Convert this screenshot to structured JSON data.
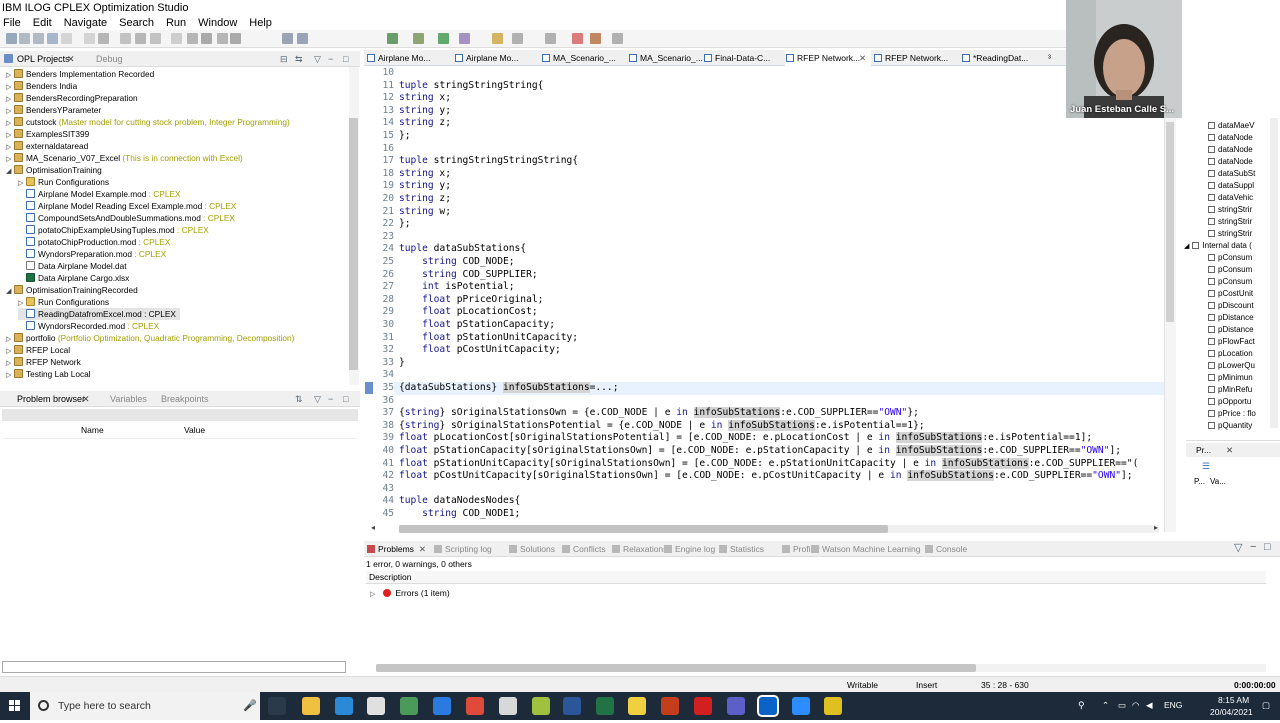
{
  "window": {
    "title": "IBM ILOG CPLEX Optimization Studio"
  },
  "menu": [
    "File",
    "Edit",
    "Navigate",
    "Search",
    "Run",
    "Window",
    "Help"
  ],
  "left_top": {
    "tab_active": "OPL Projects",
    "tab_inactive": "Debug"
  },
  "tree": [
    {
      "exp": "▷",
      "indent": 0,
      "icon": "proj",
      "label": "Benders Implementation Recorded",
      "note": ""
    },
    {
      "exp": "▷",
      "indent": 0,
      "icon": "proj",
      "label": "Benders India",
      "note": ""
    },
    {
      "exp": "▷",
      "indent": 0,
      "icon": "proj",
      "label": "BendersRecordingPreparation",
      "note": ""
    },
    {
      "exp": "▷",
      "indent": 0,
      "icon": "proj",
      "label": "BendersYParameter",
      "note": ""
    },
    {
      "exp": "▷",
      "indent": 0,
      "icon": "proj",
      "label": "cutstock",
      "note": " (Master model for cutting stock problem, Integer Programming)"
    },
    {
      "exp": "▷",
      "indent": 0,
      "icon": "proj",
      "label": "ExamplesSIT399",
      "note": ""
    },
    {
      "exp": "▷",
      "indent": 0,
      "icon": "proj",
      "label": "externaldataread",
      "note": ""
    },
    {
      "exp": "▷",
      "indent": 0,
      "icon": "proj",
      "label": "MA_Scenario_V07_Excel",
      "note": " (This is in connection with Excel)"
    },
    {
      "exp": "◢",
      "indent": 0,
      "icon": "proj",
      "label": "OptimisationTraining",
      "note": ""
    },
    {
      "exp": "▷",
      "indent": 1,
      "icon": "run",
      "label": "Run Configurations",
      "note": ""
    },
    {
      "exp": "",
      "indent": 1,
      "icon": "mod",
      "label": "Airplane Model Example.mod",
      "note": " : CPLEX"
    },
    {
      "exp": "",
      "indent": 1,
      "icon": "mod",
      "label": "Airplane Model Reading Excel Example.mod",
      "note": " : CPLEX"
    },
    {
      "exp": "",
      "indent": 1,
      "icon": "mod",
      "label": "CompoundSetsAndDoubleSummations.mod",
      "note": " : CPLEX"
    },
    {
      "exp": "",
      "indent": 1,
      "icon": "mod",
      "label": "potatoChipExampleUsingTuples.mod",
      "note": " : CPLEX"
    },
    {
      "exp": "",
      "indent": 1,
      "icon": "mod",
      "label": "potatoChipProduction.mod",
      "note": " : CPLEX"
    },
    {
      "exp": "",
      "indent": 1,
      "icon": "mod",
      "label": "WyndorsPreparation.mod",
      "note": " : CPLEX"
    },
    {
      "exp": "",
      "indent": 1,
      "icon": "dat",
      "label": "Data Airplane Model.dat",
      "note": ""
    },
    {
      "exp": "",
      "indent": 1,
      "icon": "xls",
      "label": "Data Airplane Cargo.xlsx",
      "note": ""
    },
    {
      "exp": "◢",
      "indent": 0,
      "icon": "proj",
      "label": "OptimisationTrainingRecorded",
      "note": ""
    },
    {
      "exp": "▷",
      "indent": 1,
      "icon": "run",
      "label": "Run Configurations",
      "note": ""
    },
    {
      "exp": "",
      "indent": 1,
      "icon": "mod",
      "label": "ReadingDatafromExcel.mod : CPLEX",
      "note": "",
      "selected": true
    },
    {
      "exp": "",
      "indent": 1,
      "icon": "mod",
      "label": "WyndorsRecorded.mod",
      "note": " : CPLEX"
    },
    {
      "exp": "▷",
      "indent": 0,
      "icon": "proj",
      "label": "portfolio",
      "note": " (Portfolio Optimization, Quadratic Programming, Decomposition)"
    },
    {
      "exp": "▷",
      "indent": 0,
      "icon": "proj",
      "label": "RFEP Local",
      "note": ""
    },
    {
      "exp": "▷",
      "indent": 0,
      "icon": "proj",
      "label": "RFEP Network",
      "note": ""
    },
    {
      "exp": "▷",
      "indent": 0,
      "icon": "proj",
      "label": "Testing Lab Local",
      "note": ""
    }
  ],
  "left_bottom": {
    "tab_active": "Problem browser",
    "tab2": "Variables",
    "tab3": "Breakpoints",
    "col_name": "Name",
    "col_value": "Value"
  },
  "editor_tabs": [
    {
      "label": "Airplane Mo...",
      "active": false
    },
    {
      "label": "Airplane Mo...",
      "active": false
    },
    {
      "label": "MA_Scenario_...",
      "active": false
    },
    {
      "label": "MA_Scenario_...",
      "active": false
    },
    {
      "label": "Final-Data-C...",
      "active": false
    },
    {
      "label": "RFEP Network...",
      "active": true
    },
    {
      "label": "RFEP Network...",
      "active": false
    },
    {
      "label": "*ReadingDat...",
      "active": false
    },
    {
      "label": "³",
      "active": false
    }
  ],
  "code": [
    {
      "n": "10",
      "t": ""
    },
    {
      "n": "11",
      "t": "tuple stringStringString{"
    },
    {
      "n": "12",
      "t": "string x;"
    },
    {
      "n": "13",
      "t": "string y;"
    },
    {
      "n": "14",
      "t": "string z;"
    },
    {
      "n": "15",
      "t": "};"
    },
    {
      "n": "16",
      "t": ""
    },
    {
      "n": "17",
      "t": "tuple stringStringStringString{"
    },
    {
      "n": "18",
      "t": "string x;"
    },
    {
      "n": "19",
      "t": "string y;"
    },
    {
      "n": "20",
      "t": "string z;"
    },
    {
      "n": "21",
      "t": "string w;"
    },
    {
      "n": "22",
      "t": "};"
    },
    {
      "n": "23",
      "t": ""
    },
    {
      "n": "24",
      "t": "tuple dataSubStations{"
    },
    {
      "n": "25",
      "t": "    string COD_NODE;"
    },
    {
      "n": "26",
      "t": "    string COD_SUPPLIER;"
    },
    {
      "n": "27",
      "t": "    int isPotential;"
    },
    {
      "n": "28",
      "t": "    float pPriceOriginal;"
    },
    {
      "n": "29",
      "t": "    float pLocationCost;"
    },
    {
      "n": "30",
      "t": "    float pStationCapacity;"
    },
    {
      "n": "31",
      "t": "    float pStationUnitCapacity;"
    },
    {
      "n": "32",
      "t": "    float pCostUnitCapacity;"
    },
    {
      "n": "33",
      "t": "}"
    },
    {
      "n": "34",
      "t": ""
    },
    {
      "n": "35",
      "t": "{dataSubStations} infoSubStations=...;",
      "current": true
    },
    {
      "n": "36",
      "t": ""
    },
    {
      "n": "37",
      "t": "{string} sOriginalStationsOwn = {e.COD_NODE | e in infoSubStations:e.COD_SUPPLIER==\"OWN\"};"
    },
    {
      "n": "38",
      "t": "{string} sOriginalStationsPotential = {e.COD_NODE | e in infoSubStations:e.isPotential==1};"
    },
    {
      "n": "39",
      "t": "float pLocationCost[sOriginalStationsPotential] = [e.COD_NODE: e.pLocationCost | e in infoSubStations:e.isPotential==1];"
    },
    {
      "n": "40",
      "t": "float pStationCapacity[sOriginalStationsOwn] = [e.COD_NODE: e.pStationCapacity | e in infoSubStations:e.COD_SUPPLIER==\"OWN\"];"
    },
    {
      "n": "41",
      "t": "float pStationUnitCapacity[sOriginalStationsOwn] = [e.COD_NODE: e.pStationUnitCapacity | e in infoSubStations:e.COD_SUPPLIER==\"("
    },
    {
      "n": "42",
      "t": "float pCostUnitCapacity[sOriginalStationsOwn] = [e.COD_NODE: e.pCostUnitCapacity | e in infoSubStations:e.COD_SUPPLIER==\"OWN\"];"
    },
    {
      "n": "43",
      "t": ""
    },
    {
      "n": "44",
      "t": "tuple dataNodesNodes{"
    },
    {
      "n": "45",
      "t": "    string COD_NODE1;"
    }
  ],
  "outline": [
    {
      "indent": 2,
      "label": "dataMaeV"
    },
    {
      "indent": 2,
      "label": "dataNode"
    },
    {
      "indent": 2,
      "label": "dataNode"
    },
    {
      "indent": 2,
      "label": "dataNode"
    },
    {
      "indent": 2,
      "label": "dataSubSt"
    },
    {
      "indent": 2,
      "label": "dataSuppl"
    },
    {
      "indent": 2,
      "label": "dataVehic"
    },
    {
      "indent": 2,
      "label": "stringStrir"
    },
    {
      "indent": 2,
      "label": "stringStrir"
    },
    {
      "indent": 2,
      "label": "stringStrir"
    },
    {
      "indent": 1,
      "label": "Internal data ("
    },
    {
      "indent": 2,
      "label": "pConsum"
    },
    {
      "indent": 2,
      "label": "pConsum"
    },
    {
      "indent": 2,
      "label": "pConsum"
    },
    {
      "indent": 2,
      "label": "pCostUnit"
    },
    {
      "indent": 2,
      "label": "pDiscount"
    },
    {
      "indent": 2,
      "label": "pDistance"
    },
    {
      "indent": 2,
      "label": "pDistance"
    },
    {
      "indent": 2,
      "label": "pFlowFact"
    },
    {
      "indent": 2,
      "label": "pLocation"
    },
    {
      "indent": 2,
      "label": "pLowerQu"
    },
    {
      "indent": 2,
      "label": "pMinimun"
    },
    {
      "indent": 2,
      "label": "pMinRefu"
    },
    {
      "indent": 2,
      "label": "pOpportu"
    },
    {
      "indent": 2,
      "label": "pPrice : flo"
    },
    {
      "indent": 2,
      "label": "pQuantity"
    }
  ],
  "right_small": {
    "tab": "Pr...",
    "col1": "P...",
    "col2": "Va..."
  },
  "bottom_tabs": [
    "Problems",
    "Scripting log",
    "Solutions",
    "Conflicts",
    "Relaxations",
    "Engine log",
    "Statistics",
    "Profiler",
    "Watson Machine Learning",
    "Console"
  ],
  "problems": {
    "summary": "1 error, 0 warnings, 0 others",
    "col": "Description",
    "row": "Errors (1 item)"
  },
  "status": {
    "writable": "Writable",
    "mode": "Insert",
    "pos": "35 : 28 - 630",
    "clock": "0:00:00:00"
  },
  "taskbar": {
    "search": "Type here to search",
    "lang": "ENG",
    "time": "8:15 AM",
    "date": "20/04/2021"
  },
  "webcam": {
    "name": "Juan Esteban Calle S..."
  }
}
